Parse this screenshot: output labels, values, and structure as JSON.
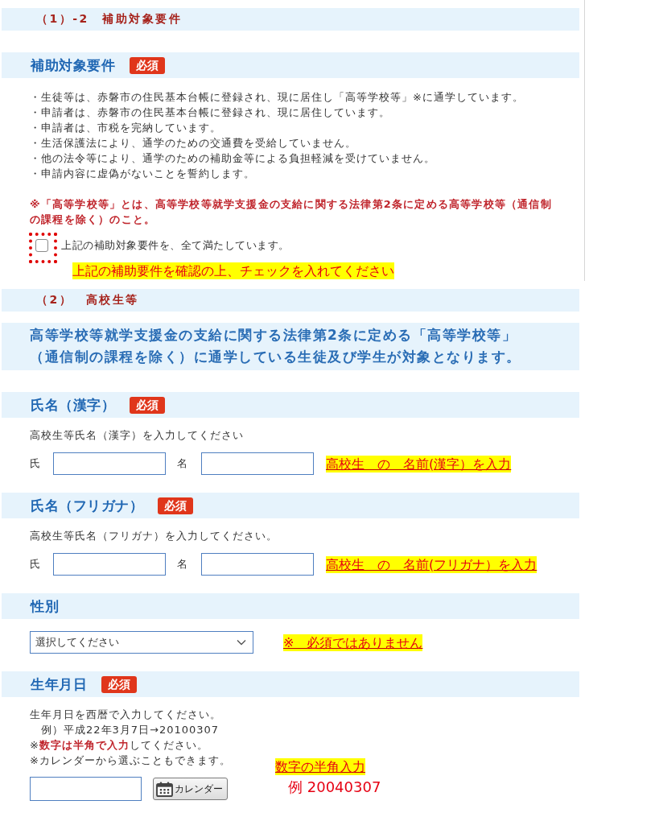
{
  "requirements_section": {
    "title": "（1）-2　補助対象要件",
    "heading": "補助対象要件",
    "badge": "必須",
    "items": [
      "・生徒等は、赤磐市の住民基本台帳に登録され、現に居住し「高等学校等」※に通学しています。",
      "・申請者は、赤磐市の住民基本台帳に登録され、現に居住しています。",
      "・申請者は、市税を完納しています。",
      "・生活保護法により、通学のための交通費を受給していません。",
      "・他の法令等により、通学のための補助金等による負担軽減を受けていません。",
      "・申請内容に虚偽がないことを誓約します。"
    ],
    "note": "※「高等学校等」とは、高等学校等就学支援金の支給に関する法律第2条に定める高等学校等（通信制の課程を除く）のこと。",
    "agreement": {
      "label": "上記の補助対象要件を、全て満たしています。",
      "checked": false
    },
    "annotation": "上記の補助要件を確認の上、チェックを入れてください"
  },
  "student_section": {
    "title": "（2）　高校生等",
    "lead": "高等学校等就学支援金の支給に関する法律第2条に定める「高等学校等」（通信制の課程を除く）に通学している生徒及び学生が対象となります。",
    "fields": [
      {
        "kind": "name_pair",
        "heading": "氏名（漢字）",
        "badge": "必須",
        "hint": "高校生等氏名（漢字）を入力してください",
        "inputs": [
          {
            "label": "氏"
          },
          {
            "label": "名"
          }
        ],
        "annotation": "高校生　の　名前(漢字）を入力"
      },
      {
        "kind": "name_pair",
        "heading": "氏名（フリガナ）",
        "badge": "必須",
        "hint": "高校生等氏名（フリガナ）を入力してください。",
        "inputs": [
          {
            "label": "氏"
          },
          {
            "label": "名"
          }
        ],
        "annotation": "高校生　の　名前(フリガナ）を入力"
      },
      {
        "kind": "select",
        "heading": "性別",
        "value": "選択してください",
        "annotation": "※　必須ではありません"
      },
      {
        "kind": "date",
        "heading": "生年月日",
        "badge": "必須",
        "hint_lines": [
          "生年月日を西暦で入力してください。",
          "　例）平成22年3月7日→20100307",
          "※**数字は半角で入力**してください。",
          "※カレンダーから選ぶこともできます。"
        ],
        "button": "カレンダー",
        "annotation": "数字の半角入力",
        "example": "例 20040307"
      }
    ]
  }
}
